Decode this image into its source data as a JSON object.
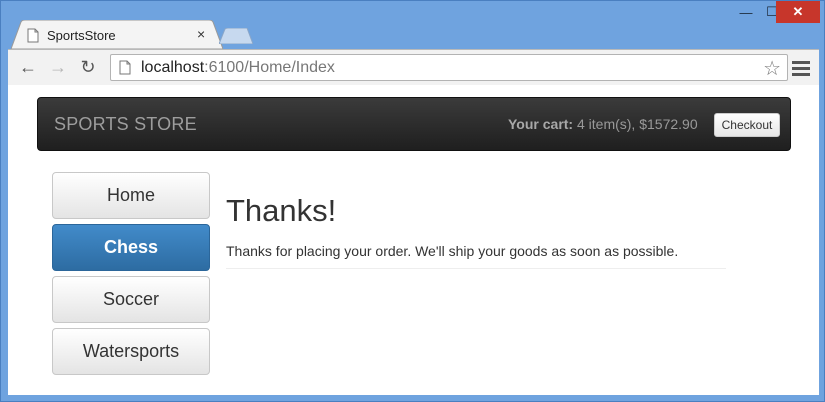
{
  "browser": {
    "tab_title": "SportsStore",
    "tab_close": "×",
    "url_host": "localhost",
    "url_path": ":6100/Home/Index",
    "win_min": "—",
    "win_max": "☐",
    "win_close": "✕",
    "back": "←",
    "forward": "→",
    "reload": "↻",
    "star": "☆"
  },
  "navbar": {
    "brand": "SPORTS STORE",
    "cart_label": "Your cart:",
    "cart_summary": " 4 item(s), $1572.90",
    "checkout": "Checkout"
  },
  "categories": [
    {
      "label": "Home",
      "active": false
    },
    {
      "label": "Chess",
      "active": true
    },
    {
      "label": "Soccer",
      "active": false
    },
    {
      "label": "Watersports",
      "active": false
    }
  ],
  "main": {
    "heading": "Thanks!",
    "message": "Thanks for placing your order. We'll ship your goods as soon as possible."
  },
  "colors": {
    "navbar_bg": "#222222",
    "active_category": "#3071a9",
    "window_frame": "#6fa3df",
    "close_button": "#c7362b"
  },
  "icons": [
    "page-icon",
    "back-icon",
    "forward-icon",
    "reload-icon",
    "star-icon",
    "menu-icon",
    "close-icon"
  ]
}
